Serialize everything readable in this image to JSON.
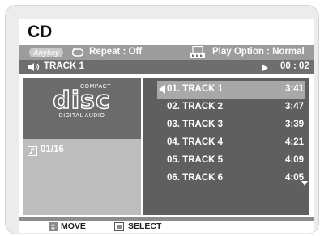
{
  "title": "CD",
  "options": {
    "badge": "Anykey",
    "repeat_label": "Repeat : Off",
    "play_option_label": "Play Option : Normal"
  },
  "now_playing": {
    "track_label": "TRACK 1",
    "time": "00 : 02"
  },
  "disc_logo": {
    "line1": "COMPACT",
    "line2": "disc",
    "line3": "DIGITAL AUDIO"
  },
  "track_counter": "01/16",
  "tracks": [
    {
      "name": "01. TRACK 1",
      "duration": "3:41"
    },
    {
      "name": "02. TRACK 2",
      "duration": "3:47"
    },
    {
      "name": "03. TRACK 3",
      "duration": "3:39"
    },
    {
      "name": "04. TRACK 4",
      "duration": "4:21"
    },
    {
      "name": "05. TRACK 5",
      "duration": "4:09"
    },
    {
      "name": "06. TRACK 6",
      "duration": "4:05"
    }
  ],
  "help": {
    "move_label": "MOVE",
    "select_label": "SELECT"
  }
}
